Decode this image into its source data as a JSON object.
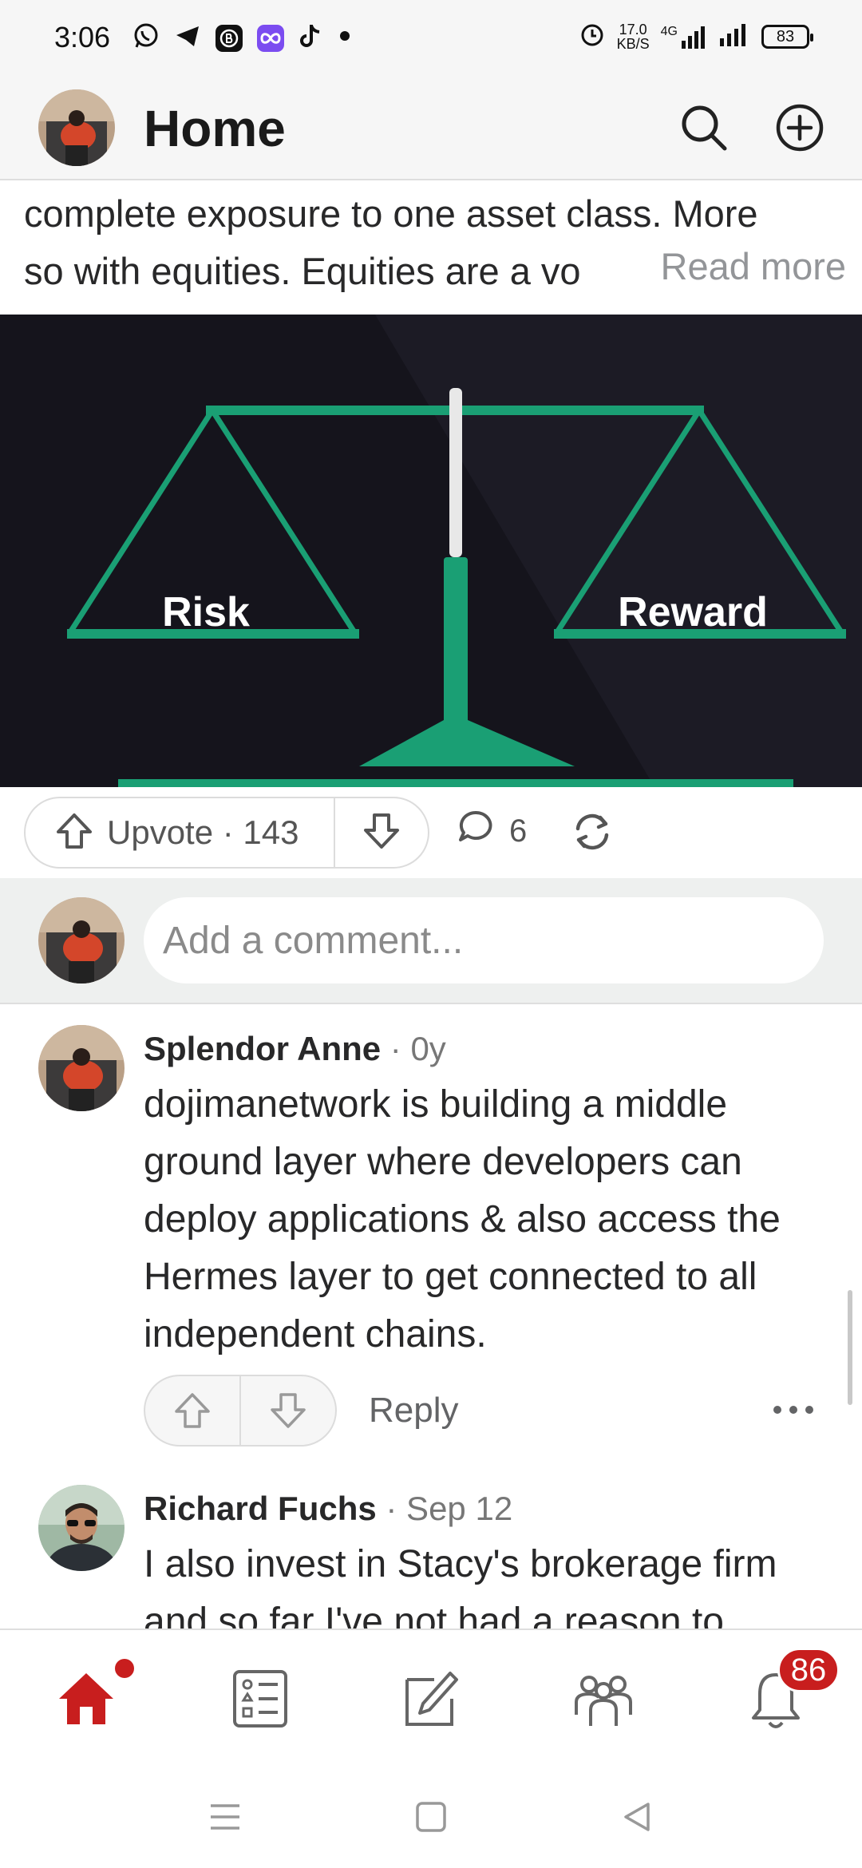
{
  "status_bar": {
    "time": "3:06",
    "net_speed_value": "17.0",
    "net_speed_unit": "KB/S",
    "network_type": "4G",
    "battery": "83",
    "notification_icons": [
      "whatsapp-icon",
      "telegram-icon",
      "binance-icon",
      "infinity-app-icon",
      "tiktok-icon"
    ]
  },
  "header": {
    "title": "Home"
  },
  "post": {
    "text_line1": "complete exposure to one asset class. More",
    "text_line2": "so with equities. Equities are a vo",
    "read_more": "Read more",
    "image": {
      "left_label": "Risk",
      "right_label": "Reward"
    },
    "upvote_label": "Upvote · 143",
    "comments_count": "6"
  },
  "add_comment": {
    "placeholder": "Add a comment..."
  },
  "comments": [
    {
      "author": "Splendor Anne",
      "meta": " · 0y",
      "body": "dojimanetwork is building a middle ground layer where developers can deploy applications & also access the Hermes layer to get connected to all independent chains.",
      "reply_label": "Reply"
    },
    {
      "author": "Richard Fuchs",
      "meta": " · Sep 12",
      "body": "I also invest in Stacy's brokerage firm and so far I've not had a reason to"
    }
  ],
  "bottom_nav": {
    "items": [
      "home-icon",
      "following-icon",
      "write-icon",
      "spaces-icon",
      "notifications-icon"
    ],
    "notification_badge": "86"
  },
  "colors": {
    "accent": "#c81e1e",
    "scale_green": "#1a9f74",
    "image_bg": "#15141c"
  }
}
